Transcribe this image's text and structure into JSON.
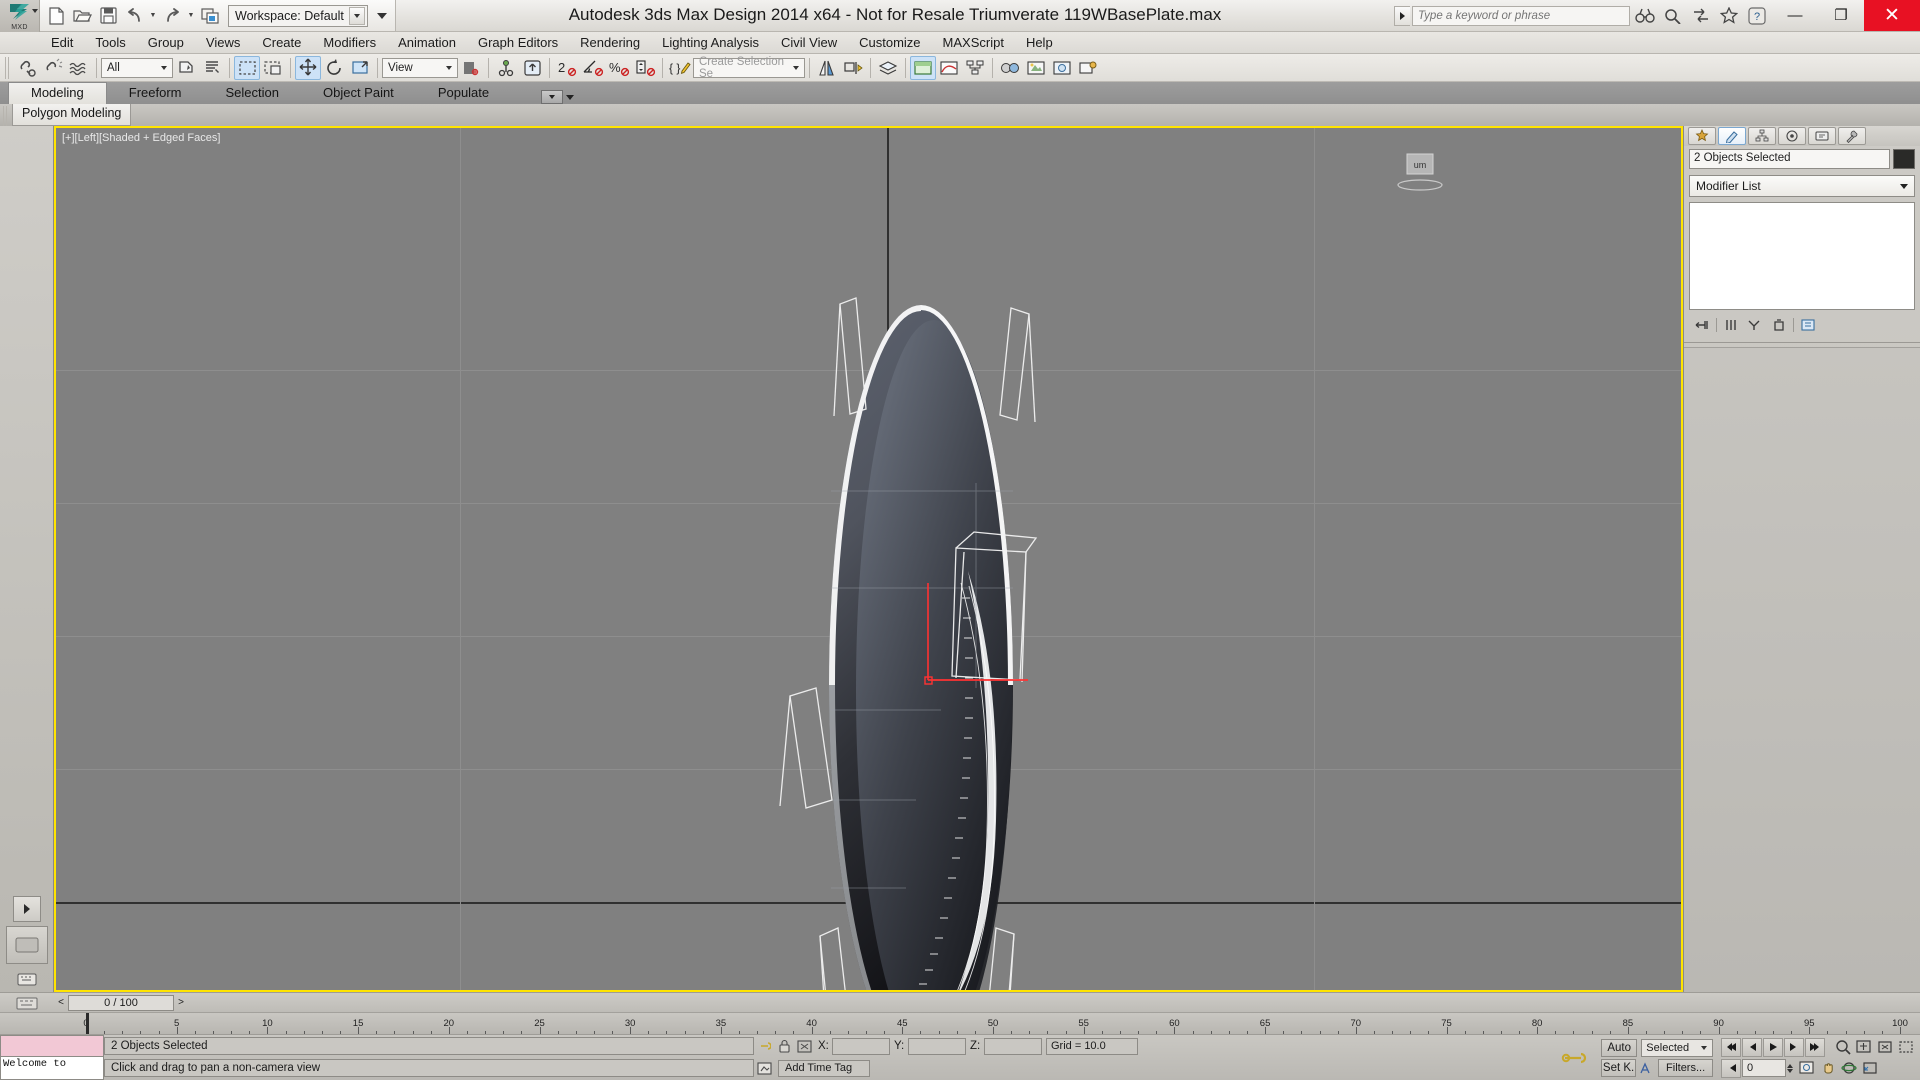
{
  "app": {
    "logo_label": "MXD",
    "title": "Autodesk 3ds Max Design 2014 x64   - Not for Resale    Triumverate 119WBasePlate.max",
    "workspace_label": "Workspace: Default"
  },
  "quick_access": [
    {
      "name": "new-file-icon",
      "label": "New"
    },
    {
      "name": "open-file-icon",
      "label": "Open"
    },
    {
      "name": "save-file-icon",
      "label": "Save"
    },
    {
      "name": "undo-icon",
      "label": "Undo"
    },
    {
      "name": "redo-icon",
      "label": "Redo"
    },
    {
      "name": "project-folder-icon",
      "label": "Set Project Folder"
    }
  ],
  "search": {
    "placeholder": "Type a keyword or phrase",
    "value": ""
  },
  "title_icons": [
    {
      "name": "binoculars-icon",
      "label": "Search"
    },
    {
      "name": "help-search-icon",
      "label": "Autodesk 360"
    },
    {
      "name": "exchange-icon",
      "label": "Exchange App Store"
    },
    {
      "name": "favorites-star-icon",
      "label": "Favorites"
    },
    {
      "name": "help-icon",
      "label": "Help"
    }
  ],
  "window_buttons": {
    "minimize": "—",
    "maximize": "❐",
    "close": "✕"
  },
  "menu": {
    "items": [
      "Edit",
      "Tools",
      "Group",
      "Views",
      "Create",
      "Modifiers",
      "Animation",
      "Graph Editors",
      "Rendering",
      "Lighting Analysis",
      "Civil View",
      "Customize",
      "MAXScript",
      "Help"
    ]
  },
  "toolbar": {
    "selection_filter": "All",
    "reference_coord_system": "View",
    "named_selection_sets_placeholder": "Create Selection Se",
    "buttons": [
      {
        "name": "select-link-icon",
        "label": "Select and Link"
      },
      {
        "name": "unlink-selection-icon",
        "label": "Unlink Selection"
      },
      {
        "name": "bind-to-spacewarp-icon",
        "label": "Bind to Space Warp"
      },
      {
        "name": "select-object-icon",
        "label": "Select Object"
      },
      {
        "name": "select-by-name-icon",
        "label": "Select by Name"
      },
      {
        "name": "rectangular-select-region-icon",
        "label": "Rectangular Selection Region"
      },
      {
        "name": "window-crossing-icon",
        "label": "Window / Crossing"
      },
      {
        "name": "select-and-move-icon",
        "label": "Select and Move"
      },
      {
        "name": "select-and-rotate-icon",
        "label": "Select and Rotate"
      },
      {
        "name": "select-and-scale-icon",
        "label": "Select and Uniform Scale"
      },
      {
        "name": "use-center-flyout-icon",
        "label": "Use Pivot Point Center"
      },
      {
        "name": "select-and-manipulate-icon",
        "label": "Select and Manipulate"
      },
      {
        "name": "snaps-toggle-icon",
        "label": "Snaps Toggle"
      },
      {
        "name": "angle-snap-icon",
        "label": "Angle Snap Toggle"
      },
      {
        "name": "percent-snap-icon",
        "label": "Percent Snap Toggle"
      },
      {
        "name": "spinner-snap-icon",
        "label": "Spinner Snap Toggle"
      },
      {
        "name": "edit-named-sets-icon",
        "label": "Edit Named Selection Sets"
      },
      {
        "name": "mirror-icon",
        "label": "Mirror"
      },
      {
        "name": "align-icon",
        "label": "Align"
      },
      {
        "name": "layer-manager-icon",
        "label": "Layer Explorer"
      },
      {
        "name": "graphite-toggle-icon",
        "label": "Toggle Ribbon"
      },
      {
        "name": "curve-editor-icon",
        "label": "Curve Editor"
      },
      {
        "name": "schematic-view-icon",
        "label": "Schematic View"
      },
      {
        "name": "material-editor-icon",
        "label": "Material Editor"
      },
      {
        "name": "render-setup-icon",
        "label": "Render Setup"
      },
      {
        "name": "rendered-frame-icon",
        "label": "Rendered Frame Window"
      },
      {
        "name": "render-production-icon",
        "label": "Render Production"
      }
    ]
  },
  "ribbon": {
    "tabs": [
      {
        "label": "Modeling",
        "active": true
      },
      {
        "label": "Freeform",
        "active": false
      },
      {
        "label": "Selection",
        "active": false
      },
      {
        "label": "Object Paint",
        "active": false
      },
      {
        "label": "Populate",
        "active": false
      }
    ],
    "panel_title": "Polygon Modeling"
  },
  "viewport": {
    "label": "[+][Left][Shaded + Edged Faces]",
    "view_cube_label": "um",
    "background": "#808080",
    "border_color": "#ffe400",
    "object_axis_color": "#ff2020"
  },
  "command_panel": {
    "tabs": [
      {
        "name": "create-tab",
        "label": "Create",
        "active": false
      },
      {
        "name": "modify-tab",
        "label": "Modify",
        "active": true
      },
      {
        "name": "hierarchy-tab",
        "label": "Hierarchy",
        "active": false
      },
      {
        "name": "motion-tab",
        "label": "Motion",
        "active": false
      },
      {
        "name": "display-tab",
        "label": "Display",
        "active": false
      },
      {
        "name": "utilities-tab",
        "label": "Utilities",
        "active": false
      }
    ],
    "object_name": "2 Objects Selected",
    "object_color": "#2a2a28",
    "modifier_list_label": "Modifier List",
    "stack_buttons": [
      {
        "name": "pin-stack-icon",
        "label": "Pin Stack"
      },
      {
        "name": "show-end-result-icon",
        "label": "Show End Result"
      },
      {
        "name": "make-unique-icon",
        "label": "Make Unique"
      },
      {
        "name": "remove-modifier-icon",
        "label": "Remove Modifier"
      },
      {
        "name": "configure-sets-icon",
        "label": "Configure Modifier Sets"
      }
    ]
  },
  "timeline": {
    "current_frame_label": "0 / 100",
    "prev_label": "<",
    "next_label": ">",
    "ruler_ticks": [
      0,
      5,
      10,
      15,
      20,
      25,
      30,
      35,
      40,
      45,
      50,
      55,
      60,
      65,
      70,
      75,
      80,
      85,
      90,
      95,
      100
    ],
    "playhead_frame": 0,
    "range_start": 0,
    "range_end": 100
  },
  "status_bar": {
    "mini_listener_text": "Welcome to",
    "selection_status": "2 Objects Selected",
    "prompt": "Click and drag to pan a non-camera view",
    "coords": [
      {
        "label": "X:",
        "value": ""
      },
      {
        "label": "Y:",
        "value": ""
      },
      {
        "label": "Z:",
        "value": ""
      }
    ],
    "grid_text": "Grid = 10.0",
    "time_tag": "Add Time Tag",
    "auto_key_label": "Auto",
    "set_key_label": "Set K.",
    "key_filter_mode": "Selected",
    "filters_label": "Filters...",
    "key_spin_value": "0",
    "playback": [
      {
        "name": "goto-start-icon",
        "label": "Go to Start"
      },
      {
        "name": "previous-frame-icon",
        "label": "Previous Frame"
      },
      {
        "name": "play-animation-icon",
        "label": "Play Animation"
      },
      {
        "name": "next-frame-icon",
        "label": "Next Frame"
      },
      {
        "name": "goto-end-icon",
        "label": "Go to End"
      }
    ],
    "nav_buttons": [
      {
        "name": "zoom-icon",
        "label": "Zoom"
      },
      {
        "name": "zoom-all-icon",
        "label": "Zoom All"
      },
      {
        "name": "zoom-extents-icon",
        "label": "Zoom Extents"
      },
      {
        "name": "zoom-region-icon",
        "label": "Zoom Region"
      },
      {
        "name": "pan-view-icon",
        "label": "Pan View"
      },
      {
        "name": "orbit-icon",
        "label": "Orbit"
      },
      {
        "name": "maximize-viewport-icon",
        "label": "Maximize Viewport Toggle"
      }
    ]
  },
  "colors": {
    "viewport_bg": "#808080",
    "viewport_border": "#ffe400",
    "chrome_light": "#e8e6e2",
    "chrome_dark": "#9d9d9d",
    "close_red": "#e81123",
    "accent_blue": "#2e6da4"
  }
}
